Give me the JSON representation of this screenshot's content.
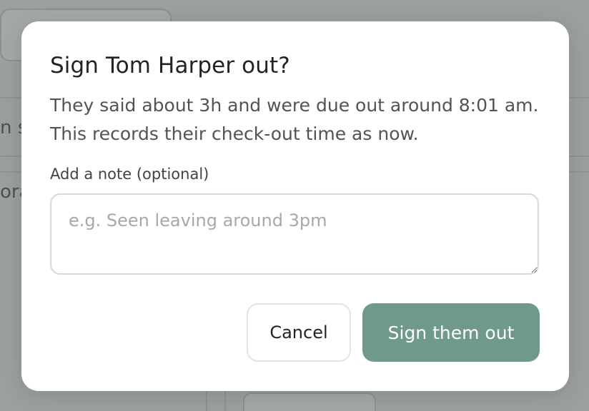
{
  "background": {
    "side_text_1": "n s",
    "side_text_2": "ora"
  },
  "dialog": {
    "title": "Sign Tom Harper out?",
    "description": "They said about 3h and were due out around 8:01 am. This records their check-out time as now.",
    "note_label": "Add a note (optional)",
    "note_placeholder": "e.g. Seen leaving around 3pm",
    "note_value": "",
    "cancel_label": "Cancel",
    "confirm_label": "Sign them out"
  },
  "colors": {
    "overlay": "#9aa09b",
    "primary_button": "#6f9a89",
    "primary_text": "#ffffff",
    "title_text": "#1f2421"
  }
}
